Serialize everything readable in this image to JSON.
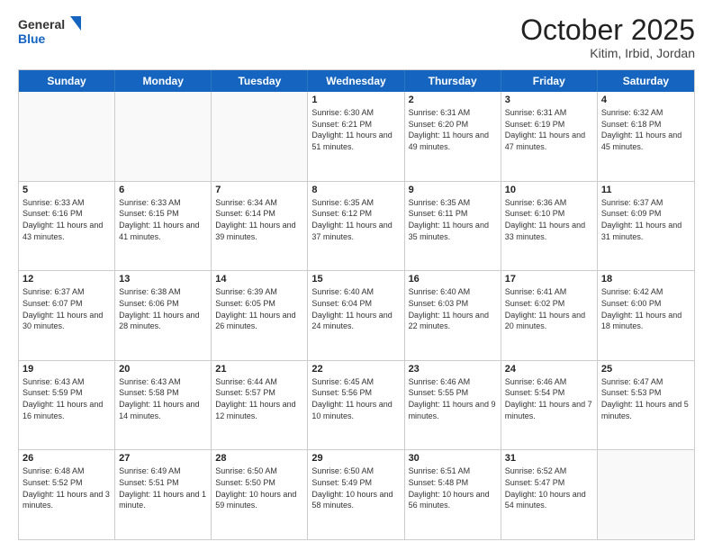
{
  "logo": {
    "general": "General",
    "blue": "Blue"
  },
  "header": {
    "month": "October 2025",
    "location": "Kitim, Irbid, Jordan"
  },
  "weekdays": [
    "Sunday",
    "Monday",
    "Tuesday",
    "Wednesday",
    "Thursday",
    "Friday",
    "Saturday"
  ],
  "rows": [
    [
      {
        "day": "",
        "sunrise": "",
        "sunset": "",
        "daylight": ""
      },
      {
        "day": "",
        "sunrise": "",
        "sunset": "",
        "daylight": ""
      },
      {
        "day": "",
        "sunrise": "",
        "sunset": "",
        "daylight": ""
      },
      {
        "day": "1",
        "sunrise": "Sunrise: 6:30 AM",
        "sunset": "Sunset: 6:21 PM",
        "daylight": "Daylight: 11 hours and 51 minutes."
      },
      {
        "day": "2",
        "sunrise": "Sunrise: 6:31 AM",
        "sunset": "Sunset: 6:20 PM",
        "daylight": "Daylight: 11 hours and 49 minutes."
      },
      {
        "day": "3",
        "sunrise": "Sunrise: 6:31 AM",
        "sunset": "Sunset: 6:19 PM",
        "daylight": "Daylight: 11 hours and 47 minutes."
      },
      {
        "day": "4",
        "sunrise": "Sunrise: 6:32 AM",
        "sunset": "Sunset: 6:18 PM",
        "daylight": "Daylight: 11 hours and 45 minutes."
      }
    ],
    [
      {
        "day": "5",
        "sunrise": "Sunrise: 6:33 AM",
        "sunset": "Sunset: 6:16 PM",
        "daylight": "Daylight: 11 hours and 43 minutes."
      },
      {
        "day": "6",
        "sunrise": "Sunrise: 6:33 AM",
        "sunset": "Sunset: 6:15 PM",
        "daylight": "Daylight: 11 hours and 41 minutes."
      },
      {
        "day": "7",
        "sunrise": "Sunrise: 6:34 AM",
        "sunset": "Sunset: 6:14 PM",
        "daylight": "Daylight: 11 hours and 39 minutes."
      },
      {
        "day": "8",
        "sunrise": "Sunrise: 6:35 AM",
        "sunset": "Sunset: 6:12 PM",
        "daylight": "Daylight: 11 hours and 37 minutes."
      },
      {
        "day": "9",
        "sunrise": "Sunrise: 6:35 AM",
        "sunset": "Sunset: 6:11 PM",
        "daylight": "Daylight: 11 hours and 35 minutes."
      },
      {
        "day": "10",
        "sunrise": "Sunrise: 6:36 AM",
        "sunset": "Sunset: 6:10 PM",
        "daylight": "Daylight: 11 hours and 33 minutes."
      },
      {
        "day": "11",
        "sunrise": "Sunrise: 6:37 AM",
        "sunset": "Sunset: 6:09 PM",
        "daylight": "Daylight: 11 hours and 31 minutes."
      }
    ],
    [
      {
        "day": "12",
        "sunrise": "Sunrise: 6:37 AM",
        "sunset": "Sunset: 6:07 PM",
        "daylight": "Daylight: 11 hours and 30 minutes."
      },
      {
        "day": "13",
        "sunrise": "Sunrise: 6:38 AM",
        "sunset": "Sunset: 6:06 PM",
        "daylight": "Daylight: 11 hours and 28 minutes."
      },
      {
        "day": "14",
        "sunrise": "Sunrise: 6:39 AM",
        "sunset": "Sunset: 6:05 PM",
        "daylight": "Daylight: 11 hours and 26 minutes."
      },
      {
        "day": "15",
        "sunrise": "Sunrise: 6:40 AM",
        "sunset": "Sunset: 6:04 PM",
        "daylight": "Daylight: 11 hours and 24 minutes."
      },
      {
        "day": "16",
        "sunrise": "Sunrise: 6:40 AM",
        "sunset": "Sunset: 6:03 PM",
        "daylight": "Daylight: 11 hours and 22 minutes."
      },
      {
        "day": "17",
        "sunrise": "Sunrise: 6:41 AM",
        "sunset": "Sunset: 6:02 PM",
        "daylight": "Daylight: 11 hours and 20 minutes."
      },
      {
        "day": "18",
        "sunrise": "Sunrise: 6:42 AM",
        "sunset": "Sunset: 6:00 PM",
        "daylight": "Daylight: 11 hours and 18 minutes."
      }
    ],
    [
      {
        "day": "19",
        "sunrise": "Sunrise: 6:43 AM",
        "sunset": "Sunset: 5:59 PM",
        "daylight": "Daylight: 11 hours and 16 minutes."
      },
      {
        "day": "20",
        "sunrise": "Sunrise: 6:43 AM",
        "sunset": "Sunset: 5:58 PM",
        "daylight": "Daylight: 11 hours and 14 minutes."
      },
      {
        "day": "21",
        "sunrise": "Sunrise: 6:44 AM",
        "sunset": "Sunset: 5:57 PM",
        "daylight": "Daylight: 11 hours and 12 minutes."
      },
      {
        "day": "22",
        "sunrise": "Sunrise: 6:45 AM",
        "sunset": "Sunset: 5:56 PM",
        "daylight": "Daylight: 11 hours and 10 minutes."
      },
      {
        "day": "23",
        "sunrise": "Sunrise: 6:46 AM",
        "sunset": "Sunset: 5:55 PM",
        "daylight": "Daylight: 11 hours and 9 minutes."
      },
      {
        "day": "24",
        "sunrise": "Sunrise: 6:46 AM",
        "sunset": "Sunset: 5:54 PM",
        "daylight": "Daylight: 11 hours and 7 minutes."
      },
      {
        "day": "25",
        "sunrise": "Sunrise: 6:47 AM",
        "sunset": "Sunset: 5:53 PM",
        "daylight": "Daylight: 11 hours and 5 minutes."
      }
    ],
    [
      {
        "day": "26",
        "sunrise": "Sunrise: 6:48 AM",
        "sunset": "Sunset: 5:52 PM",
        "daylight": "Daylight: 11 hours and 3 minutes."
      },
      {
        "day": "27",
        "sunrise": "Sunrise: 6:49 AM",
        "sunset": "Sunset: 5:51 PM",
        "daylight": "Daylight: 11 hours and 1 minute."
      },
      {
        "day": "28",
        "sunrise": "Sunrise: 6:50 AM",
        "sunset": "Sunset: 5:50 PM",
        "daylight": "Daylight: 10 hours and 59 minutes."
      },
      {
        "day": "29",
        "sunrise": "Sunrise: 6:50 AM",
        "sunset": "Sunset: 5:49 PM",
        "daylight": "Daylight: 10 hours and 58 minutes."
      },
      {
        "day": "30",
        "sunrise": "Sunrise: 6:51 AM",
        "sunset": "Sunset: 5:48 PM",
        "daylight": "Daylight: 10 hours and 56 minutes."
      },
      {
        "day": "31",
        "sunrise": "Sunrise: 6:52 AM",
        "sunset": "Sunset: 5:47 PM",
        "daylight": "Daylight: 10 hours and 54 minutes."
      },
      {
        "day": "",
        "sunrise": "",
        "sunset": "",
        "daylight": ""
      }
    ]
  ]
}
